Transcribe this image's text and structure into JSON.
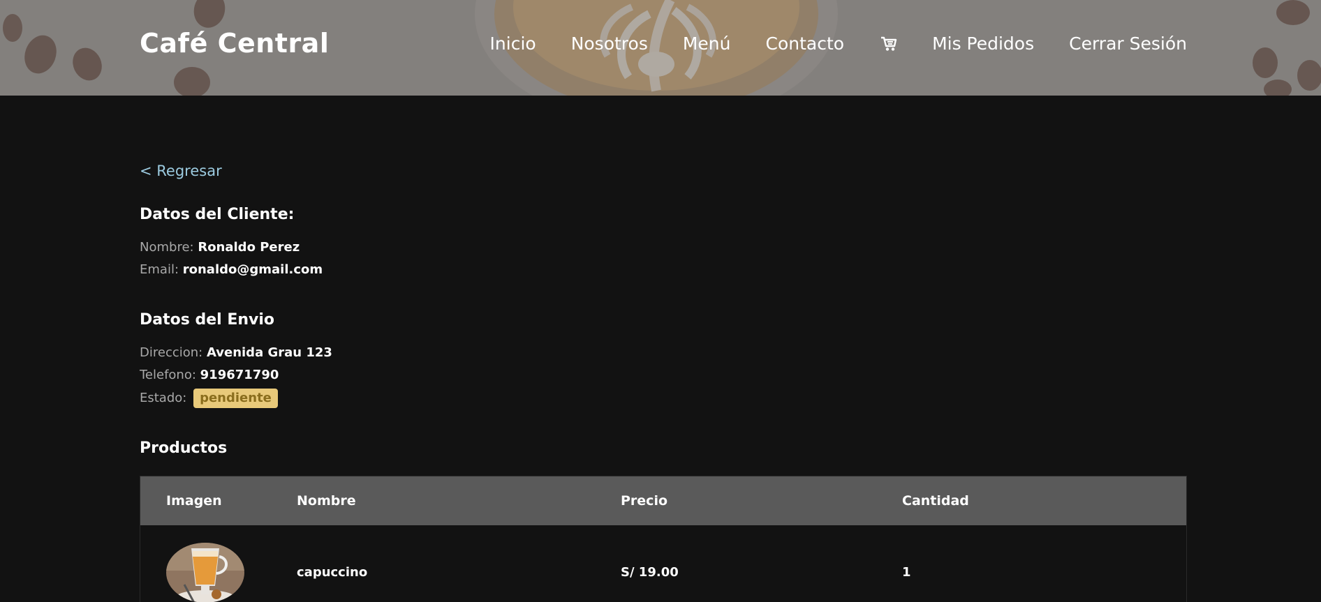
{
  "header": {
    "brand": "Café Central",
    "nav": {
      "inicio": "Inicio",
      "nosotros": "Nosotros",
      "menu": "Menú",
      "contacto": "Contacto",
      "mis_pedidos": "Mis Pedidos",
      "cerrar_sesion": "Cerrar Sesión"
    },
    "cart_icon": "shopping-cart-icon"
  },
  "back_link": "< Regresar",
  "cliente": {
    "title": "Datos del Cliente:",
    "nombre_label": "Nombre:",
    "nombre": "Ronaldo Perez",
    "email_label": "Email:",
    "email": "ronaldo@gmail.com"
  },
  "envio": {
    "title": "Datos del Envio",
    "direccion_label": "Direccion:",
    "direccion": "Avenida Grau 123",
    "telefono_label": "Telefono:",
    "telefono": "919671790",
    "estado_label": "Estado:",
    "estado": "pendiente"
  },
  "productos": {
    "title": "Productos",
    "columns": {
      "imagen": "Imagen",
      "nombre": "Nombre",
      "precio": "Precio",
      "cantidad": "Cantidad"
    },
    "rows": [
      {
        "nombre": "capuccino",
        "precio": "S/ 19.00",
        "cantidad": "1"
      }
    ]
  },
  "colors": {
    "background": "#121212",
    "link": "#9ccbe0",
    "badge_bg": "#e8c97a",
    "badge_text": "#8a6d1d",
    "table_header": "#5a5a5a"
  }
}
